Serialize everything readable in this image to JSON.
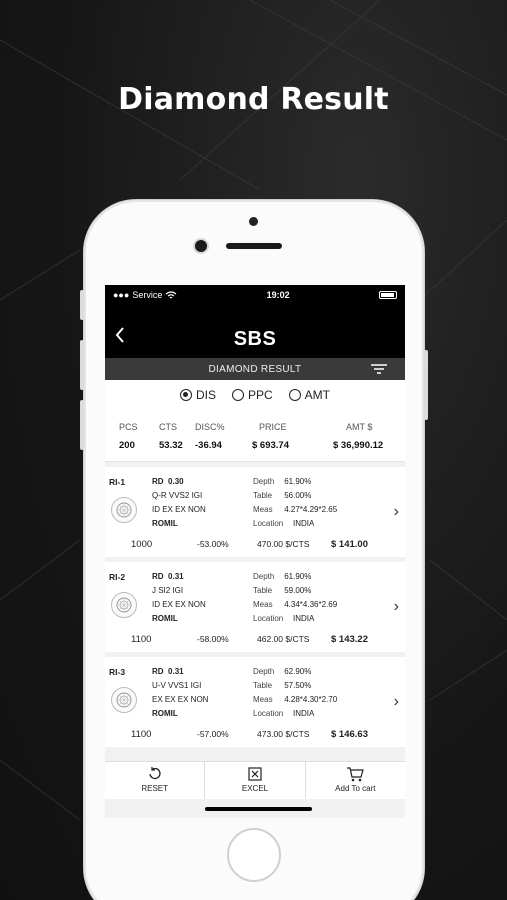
{
  "promo": {
    "headline": "Diamond Result"
  },
  "status": {
    "carrier": "Service",
    "time": "19:02"
  },
  "header": {
    "title": "SBS",
    "subtitle": "DIAMOND RESULT"
  },
  "radios": [
    {
      "label": "DIS",
      "selected": true
    },
    {
      "label": "PPC",
      "selected": false
    },
    {
      "label": "AMT",
      "selected": false
    }
  ],
  "summary": {
    "pcs_label": "PCS",
    "pcs": "200",
    "cts_label": "CTS",
    "cts": "53.32",
    "disc_label": "DISC%",
    "disc": "-36.94",
    "price_label": "PRICE",
    "price": "$  693.74",
    "amt_label": "AMT $",
    "amt": "$  36,990.12"
  },
  "results": [
    {
      "id": "RI-1",
      "shape": "RD",
      "carat": "0.30",
      "line2": "Q-R  VVS2  IGI",
      "line3": "ID  EX  EX  NON",
      "seller": "ROMIL",
      "depth": "61.90%",
      "table": "56.00%",
      "meas": "4.27*4.29*2.65",
      "location": "INDIA",
      "rap": "1000",
      "disc": "-53.00%",
      "per_ct": "470.00 $/CTS",
      "amount": "$  141.00"
    },
    {
      "id": "RI-2",
      "shape": "RD",
      "carat": "0.31",
      "line2": "J  SI2  IGI",
      "line3": "ID  EX  EX  NON",
      "seller": "ROMIL",
      "depth": "61.90%",
      "table": "59.00%",
      "meas": "4.34*4.36*2.69",
      "location": "INDIA",
      "rap": "1100",
      "disc": "-58.00%",
      "per_ct": "462.00 $/CTS",
      "amount": "$  143.22"
    },
    {
      "id": "RI-3",
      "shape": "RD",
      "carat": "0.31",
      "line2": "U-V  VVS1  IGI",
      "line3": "EX  EX  EX  NON",
      "seller": "ROMIL",
      "depth": "62.90%",
      "table": "57.50%",
      "meas": "4.28*4.30*2.70",
      "location": "INDIA",
      "rap": "1100",
      "disc": "-57.00%",
      "per_ct": "473.00 $/CTS",
      "amount": "$  146.63"
    }
  ],
  "labels": {
    "depth": "Depth",
    "table": "Table",
    "meas": "Meas",
    "location": "Location"
  },
  "actions": {
    "reset": "RESET",
    "excel": "EXCEL",
    "cart": "Add To cart"
  },
  "icons": [
    "back-chevron-icon",
    "filter-icon",
    "diamond-icon",
    "chevron-right-icon",
    "reset-icon",
    "excel-icon",
    "cart-icon",
    "wifi-icon",
    "battery-icon"
  ]
}
